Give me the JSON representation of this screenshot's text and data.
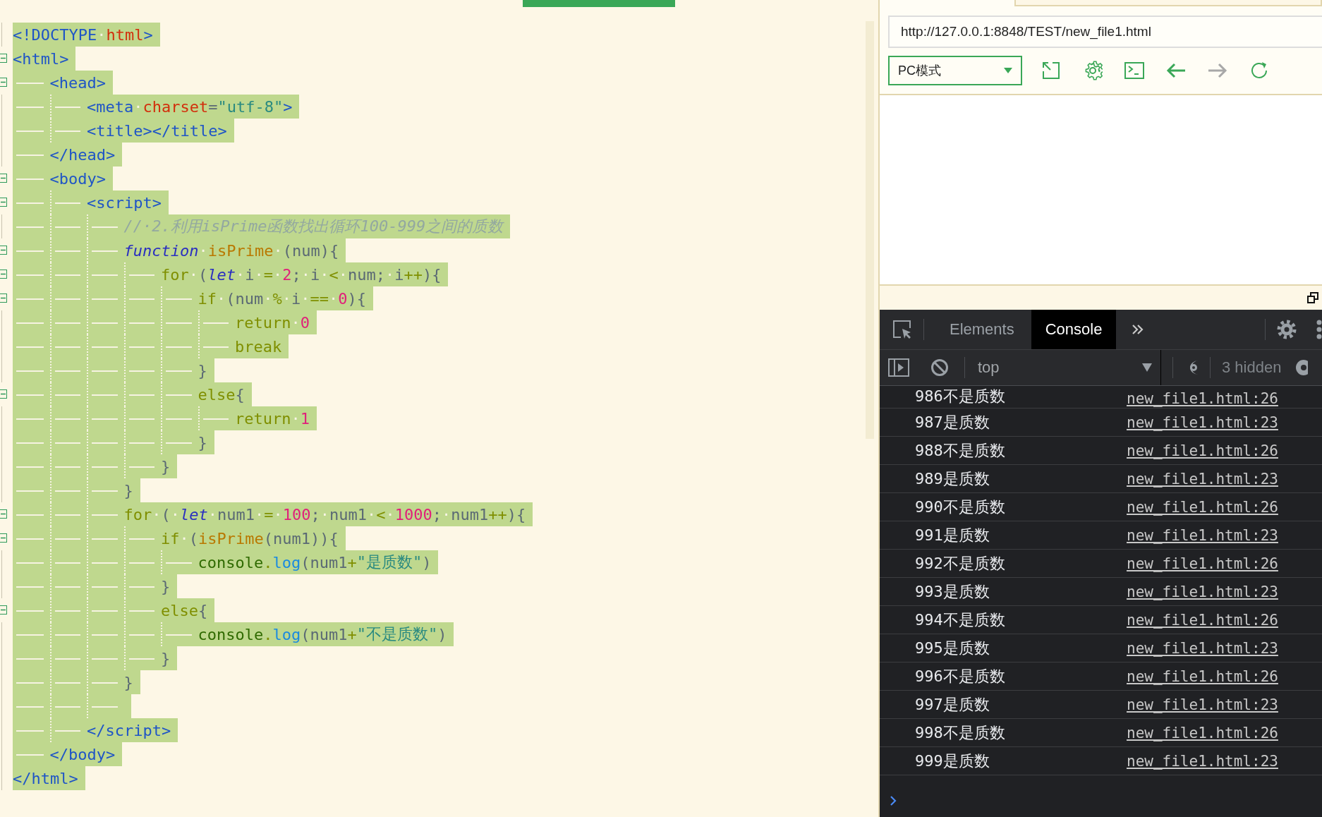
{
  "editor": {
    "lines": [
      {
        "fold": false,
        "selected": true,
        "tokens": [
          {
            "kind": "tag",
            "text": "<!DOCTYPE"
          },
          {
            "kind": "ws",
            "text": "·"
          },
          {
            "kind": "attr",
            "text": "html"
          },
          {
            "kind": "tag",
            "text": ">"
          }
        ]
      },
      {
        "fold": true,
        "selected": true,
        "tokens": [
          {
            "kind": "tag",
            "text": "<html>"
          }
        ],
        "children": [
          {
            "fold": true,
            "selected": true,
            "tokens": [
              {
                "kind": "tag",
                "text": "<head>"
              }
            ],
            "children": [
              {
                "fold": false,
                "selected": true,
                "tokens": [
                  {
                    "kind": "tag",
                    "text": "<meta"
                  },
                  {
                    "kind": "ws",
                    "text": "·"
                  },
                  {
                    "kind": "attr",
                    "text": "charset"
                  },
                  {
                    "kind": "plain",
                    "text": "="
                  },
                  {
                    "kind": "str",
                    "text": "\"utf-8\""
                  },
                  {
                    "kind": "tag",
                    "text": ">"
                  }
                ]
              },
              {
                "fold": false,
                "selected": true,
                "tokens": [
                  {
                    "kind": "tag",
                    "text": "<title></title>"
                  }
                ]
              }
            ]
          },
          {
            "fold": false,
            "selected": true,
            "tokens": [
              {
                "kind": "tag",
                "text": "</head>"
              }
            ]
          },
          {
            "fold": true,
            "selected": true,
            "tokens": [
              {
                "kind": "tag",
                "text": "<body>"
              }
            ],
            "children": [
              {
                "fold": true,
                "selected": true,
                "tokens": [
                  {
                    "kind": "tag",
                    "text": "<script>"
                  }
                ],
                "children": [
                  {
                    "fold": false,
                    "selected": true,
                    "tokens": [
                      {
                        "kind": "cmt",
                        "text": "//·2.利用isPrime函数找出循环100-999之间的质数"
                      }
                    ]
                  },
                  {
                    "fold": true,
                    "selected": true,
                    "tokens": [
                      {
                        "kind": "kw",
                        "text": "function"
                      },
                      {
                        "kind": "ws",
                        "text": "·"
                      },
                      {
                        "kind": "fn",
                        "text": "isPrime"
                      },
                      {
                        "kind": "ws",
                        "text": "·"
                      },
                      {
                        "kind": "plain",
                        "text": "(num){"
                      }
                    ],
                    "children": [
                      {
                        "fold": true,
                        "selected": true,
                        "tokens": [
                          {
                            "kind": "ctl",
                            "text": "for"
                          },
                          {
                            "kind": "ws",
                            "text": "·"
                          },
                          {
                            "kind": "plain",
                            "text": "("
                          },
                          {
                            "kind": "kw",
                            "text": "let"
                          },
                          {
                            "kind": "ws",
                            "text": "·"
                          },
                          {
                            "kind": "plain",
                            "text": "i"
                          },
                          {
                            "kind": "ws",
                            "text": "·"
                          },
                          {
                            "kind": "op",
                            "text": "="
                          },
                          {
                            "kind": "ws",
                            "text": "·"
                          },
                          {
                            "kind": "num",
                            "text": "2"
                          },
                          {
                            "kind": "plain",
                            "text": ";"
                          },
                          {
                            "kind": "ws",
                            "text": "·"
                          },
                          {
                            "kind": "plain",
                            "text": "i"
                          },
                          {
                            "kind": "ws",
                            "text": "·"
                          },
                          {
                            "kind": "op",
                            "text": "<"
                          },
                          {
                            "kind": "ws",
                            "text": "·"
                          },
                          {
                            "kind": "plain",
                            "text": "num;"
                          },
                          {
                            "kind": "ws",
                            "text": "·"
                          },
                          {
                            "kind": "plain",
                            "text": "i"
                          },
                          {
                            "kind": "op",
                            "text": "++"
                          },
                          {
                            "kind": "plain",
                            "text": "){"
                          }
                        ],
                        "children": [
                          {
                            "fold": true,
                            "selected": true,
                            "tokens": [
                              {
                                "kind": "ctl",
                                "text": "if"
                              },
                              {
                                "kind": "ws",
                                "text": "·"
                              },
                              {
                                "kind": "plain",
                                "text": "(num"
                              },
                              {
                                "kind": "ws",
                                "text": "·"
                              },
                              {
                                "kind": "op",
                                "text": "%"
                              },
                              {
                                "kind": "ws",
                                "text": "·"
                              },
                              {
                                "kind": "plain",
                                "text": "i"
                              },
                              {
                                "kind": "ws",
                                "text": "·"
                              },
                              {
                                "kind": "op",
                                "text": "=="
                              },
                              {
                                "kind": "ws",
                                "text": "·"
                              },
                              {
                                "kind": "num",
                                "text": "0"
                              },
                              {
                                "kind": "plain",
                                "text": "){"
                              }
                            ],
                            "children": [
                              {
                                "fold": false,
                                "selected": true,
                                "tokens": [
                                  {
                                    "kind": "ctl",
                                    "text": "return"
                                  },
                                  {
                                    "kind": "ws",
                                    "text": "·"
                                  },
                                  {
                                    "kind": "num",
                                    "text": "0"
                                  }
                                ]
                              },
                              {
                                "fold": false,
                                "selected": true,
                                "tokens": [
                                  {
                                    "kind": "ctl",
                                    "text": "break"
                                  }
                                ]
                              }
                            ]
                          },
                          {
                            "fold": false,
                            "selected": true,
                            "tokens": [
                              {
                                "kind": "plain",
                                "text": "}"
                              }
                            ]
                          },
                          {
                            "fold": true,
                            "selected": true,
                            "tokens": [
                              {
                                "kind": "ctl",
                                "text": "else"
                              },
                              {
                                "kind": "plain",
                                "text": "{"
                              }
                            ],
                            "children": [
                              {
                                "fold": false,
                                "selected": true,
                                "tokens": [
                                  {
                                    "kind": "ctl",
                                    "text": "return"
                                  },
                                  {
                                    "kind": "ws",
                                    "text": "·"
                                  },
                                  {
                                    "kind": "num",
                                    "text": "1"
                                  }
                                ]
                              }
                            ]
                          },
                          {
                            "fold": false,
                            "selected": true,
                            "tokens": [
                              {
                                "kind": "plain",
                                "text": "}"
                              }
                            ]
                          }
                        ]
                      },
                      {
                        "fold": false,
                        "selected": true,
                        "tokens": [
                          {
                            "kind": "plain",
                            "text": "}"
                          }
                        ]
                      }
                    ]
                  },
                  {
                    "fold": false,
                    "selected": true,
                    "tokens": [
                      {
                        "kind": "plain",
                        "text": "}"
                      }
                    ]
                  },
                  {
                    "fold": true,
                    "selected": true,
                    "tokens": [
                      {
                        "kind": "ctl",
                        "text": "for"
                      },
                      {
                        "kind": "ws",
                        "text": "·"
                      },
                      {
                        "kind": "plain",
                        "text": "("
                      },
                      {
                        "kind": "ws",
                        "text": "·"
                      },
                      {
                        "kind": "kw",
                        "text": "let"
                      },
                      {
                        "kind": "ws",
                        "text": "·"
                      },
                      {
                        "kind": "plain",
                        "text": "num1"
                      },
                      {
                        "kind": "ws",
                        "text": "·"
                      },
                      {
                        "kind": "op",
                        "text": "="
                      },
                      {
                        "kind": "ws",
                        "text": "·"
                      },
                      {
                        "kind": "num",
                        "text": "100"
                      },
                      {
                        "kind": "plain",
                        "text": ";"
                      },
                      {
                        "kind": "ws",
                        "text": "·"
                      },
                      {
                        "kind": "plain",
                        "text": "num1"
                      },
                      {
                        "kind": "ws",
                        "text": "·"
                      },
                      {
                        "kind": "op",
                        "text": "<"
                      },
                      {
                        "kind": "ws",
                        "text": "·"
                      },
                      {
                        "kind": "num",
                        "text": "1000"
                      },
                      {
                        "kind": "plain",
                        "text": ";"
                      },
                      {
                        "kind": "ws",
                        "text": "·"
                      },
                      {
                        "kind": "plain",
                        "text": "num1"
                      },
                      {
                        "kind": "op",
                        "text": "++"
                      },
                      {
                        "kind": "plain",
                        "text": "){"
                      }
                    ],
                    "children": [
                      {
                        "fold": true,
                        "selected": true,
                        "tokens": [
                          {
                            "kind": "ctl",
                            "text": "if"
                          },
                          {
                            "kind": "ws",
                            "text": "·"
                          },
                          {
                            "kind": "plain",
                            "text": "("
                          },
                          {
                            "kind": "fn",
                            "text": "isPrime"
                          },
                          {
                            "kind": "plain",
                            "text": "(num1)){"
                          }
                        ],
                        "children": [
                          {
                            "fold": false,
                            "selected": true,
                            "tokens": [
                              {
                                "kind": "obj",
                                "text": "console"
                              },
                              {
                                "kind": "op",
                                "text": "."
                              },
                              {
                                "kind": "method",
                                "text": "log"
                              },
                              {
                                "kind": "plain",
                                "text": "(num1"
                              },
                              {
                                "kind": "op",
                                "text": "+"
                              },
                              {
                                "kind": "str",
                                "text": "\"是质数\""
                              },
                              {
                                "kind": "plain",
                                "text": ")"
                              }
                            ]
                          }
                        ]
                      },
                      {
                        "fold": false,
                        "selected": true,
                        "tokens": [
                          {
                            "kind": "plain",
                            "text": "}"
                          }
                        ]
                      },
                      {
                        "fold": true,
                        "selected": true,
                        "tokens": [
                          {
                            "kind": "ctl",
                            "text": "else"
                          },
                          {
                            "kind": "plain",
                            "text": "{"
                          }
                        ],
                        "children": [
                          {
                            "fold": false,
                            "selected": true,
                            "tokens": [
                              {
                                "kind": "obj",
                                "text": "console"
                              },
                              {
                                "kind": "op",
                                "text": "."
                              },
                              {
                                "kind": "method",
                                "text": "log"
                              },
                              {
                                "kind": "plain",
                                "text": "(num1"
                              },
                              {
                                "kind": "op",
                                "text": "+"
                              },
                              {
                                "kind": "str",
                                "text": "\"不是质数\""
                              },
                              {
                                "kind": "plain",
                                "text": ")"
                              }
                            ]
                          }
                        ]
                      },
                      {
                        "fold": false,
                        "selected": true,
                        "tokens": [
                          {
                            "kind": "plain",
                            "text": "}"
                          }
                        ]
                      }
                    ]
                  },
                  {
                    "fold": false,
                    "selected": true,
                    "tokens": [
                      {
                        "kind": "plain",
                        "text": "}"
                      }
                    ]
                  },
                  {
                    "fold": false,
                    "selected": true
                  }
                ]
              },
              {
                "fold": false,
                "selected": true,
                "tokens": [
                  {
                    "kind": "tag",
                    "text": "</script>"
                  }
                ]
              }
            ]
          },
          {
            "fold": false,
            "selected": true,
            "tokens": [
              {
                "kind": "tag",
                "text": "</body>"
              }
            ]
          }
        ]
      },
      {
        "fold": false,
        "selected": true,
        "tokens": [
          {
            "kind": "tag",
            "text": "</html>"
          }
        ]
      }
    ]
  },
  "browser": {
    "url": "http://127.0.0.1:8848/TEST/new_file1.html",
    "mode_select": {
      "value": "PC模式"
    },
    "toolbar": [
      {
        "kind": "resize",
        "disabled": false
      },
      {
        "kind": "settings",
        "disabled": false
      },
      {
        "kind": "terminal",
        "disabled": false
      },
      {
        "kind": "back",
        "disabled": false
      },
      {
        "kind": "forward",
        "disabled": true
      },
      {
        "kind": "reload",
        "disabled": false
      }
    ]
  },
  "devtools": {
    "tabs": [
      {
        "label": "Elements",
        "selected": false
      },
      {
        "label": "Console",
        "selected": true
      }
    ],
    "context": {
      "value": "top"
    },
    "hidden_count": "3 hidden",
    "messages": [
      {
        "text": "986不是质数",
        "source": "new_file1.html:26"
      },
      {
        "text": "987是质数",
        "source": "new_file1.html:23"
      },
      {
        "text": "988不是质数",
        "source": "new_file1.html:26"
      },
      {
        "text": "989是质数",
        "source": "new_file1.html:23"
      },
      {
        "text": "990不是质数",
        "source": "new_file1.html:26"
      },
      {
        "text": "991是质数",
        "source": "new_file1.html:23"
      },
      {
        "text": "992不是质数",
        "source": "new_file1.html:26"
      },
      {
        "text": "993是质数",
        "source": "new_file1.html:23"
      },
      {
        "text": "994不是质数",
        "source": "new_file1.html:26"
      },
      {
        "text": "995是质数",
        "source": "new_file1.html:23"
      },
      {
        "text": "996不是质数",
        "source": "new_file1.html:26"
      },
      {
        "text": "997是质数",
        "source": "new_file1.html:23"
      },
      {
        "text": "998不是质数",
        "source": "new_file1.html:26"
      },
      {
        "text": "999是质数",
        "source": "new_file1.html:23"
      }
    ]
  }
}
